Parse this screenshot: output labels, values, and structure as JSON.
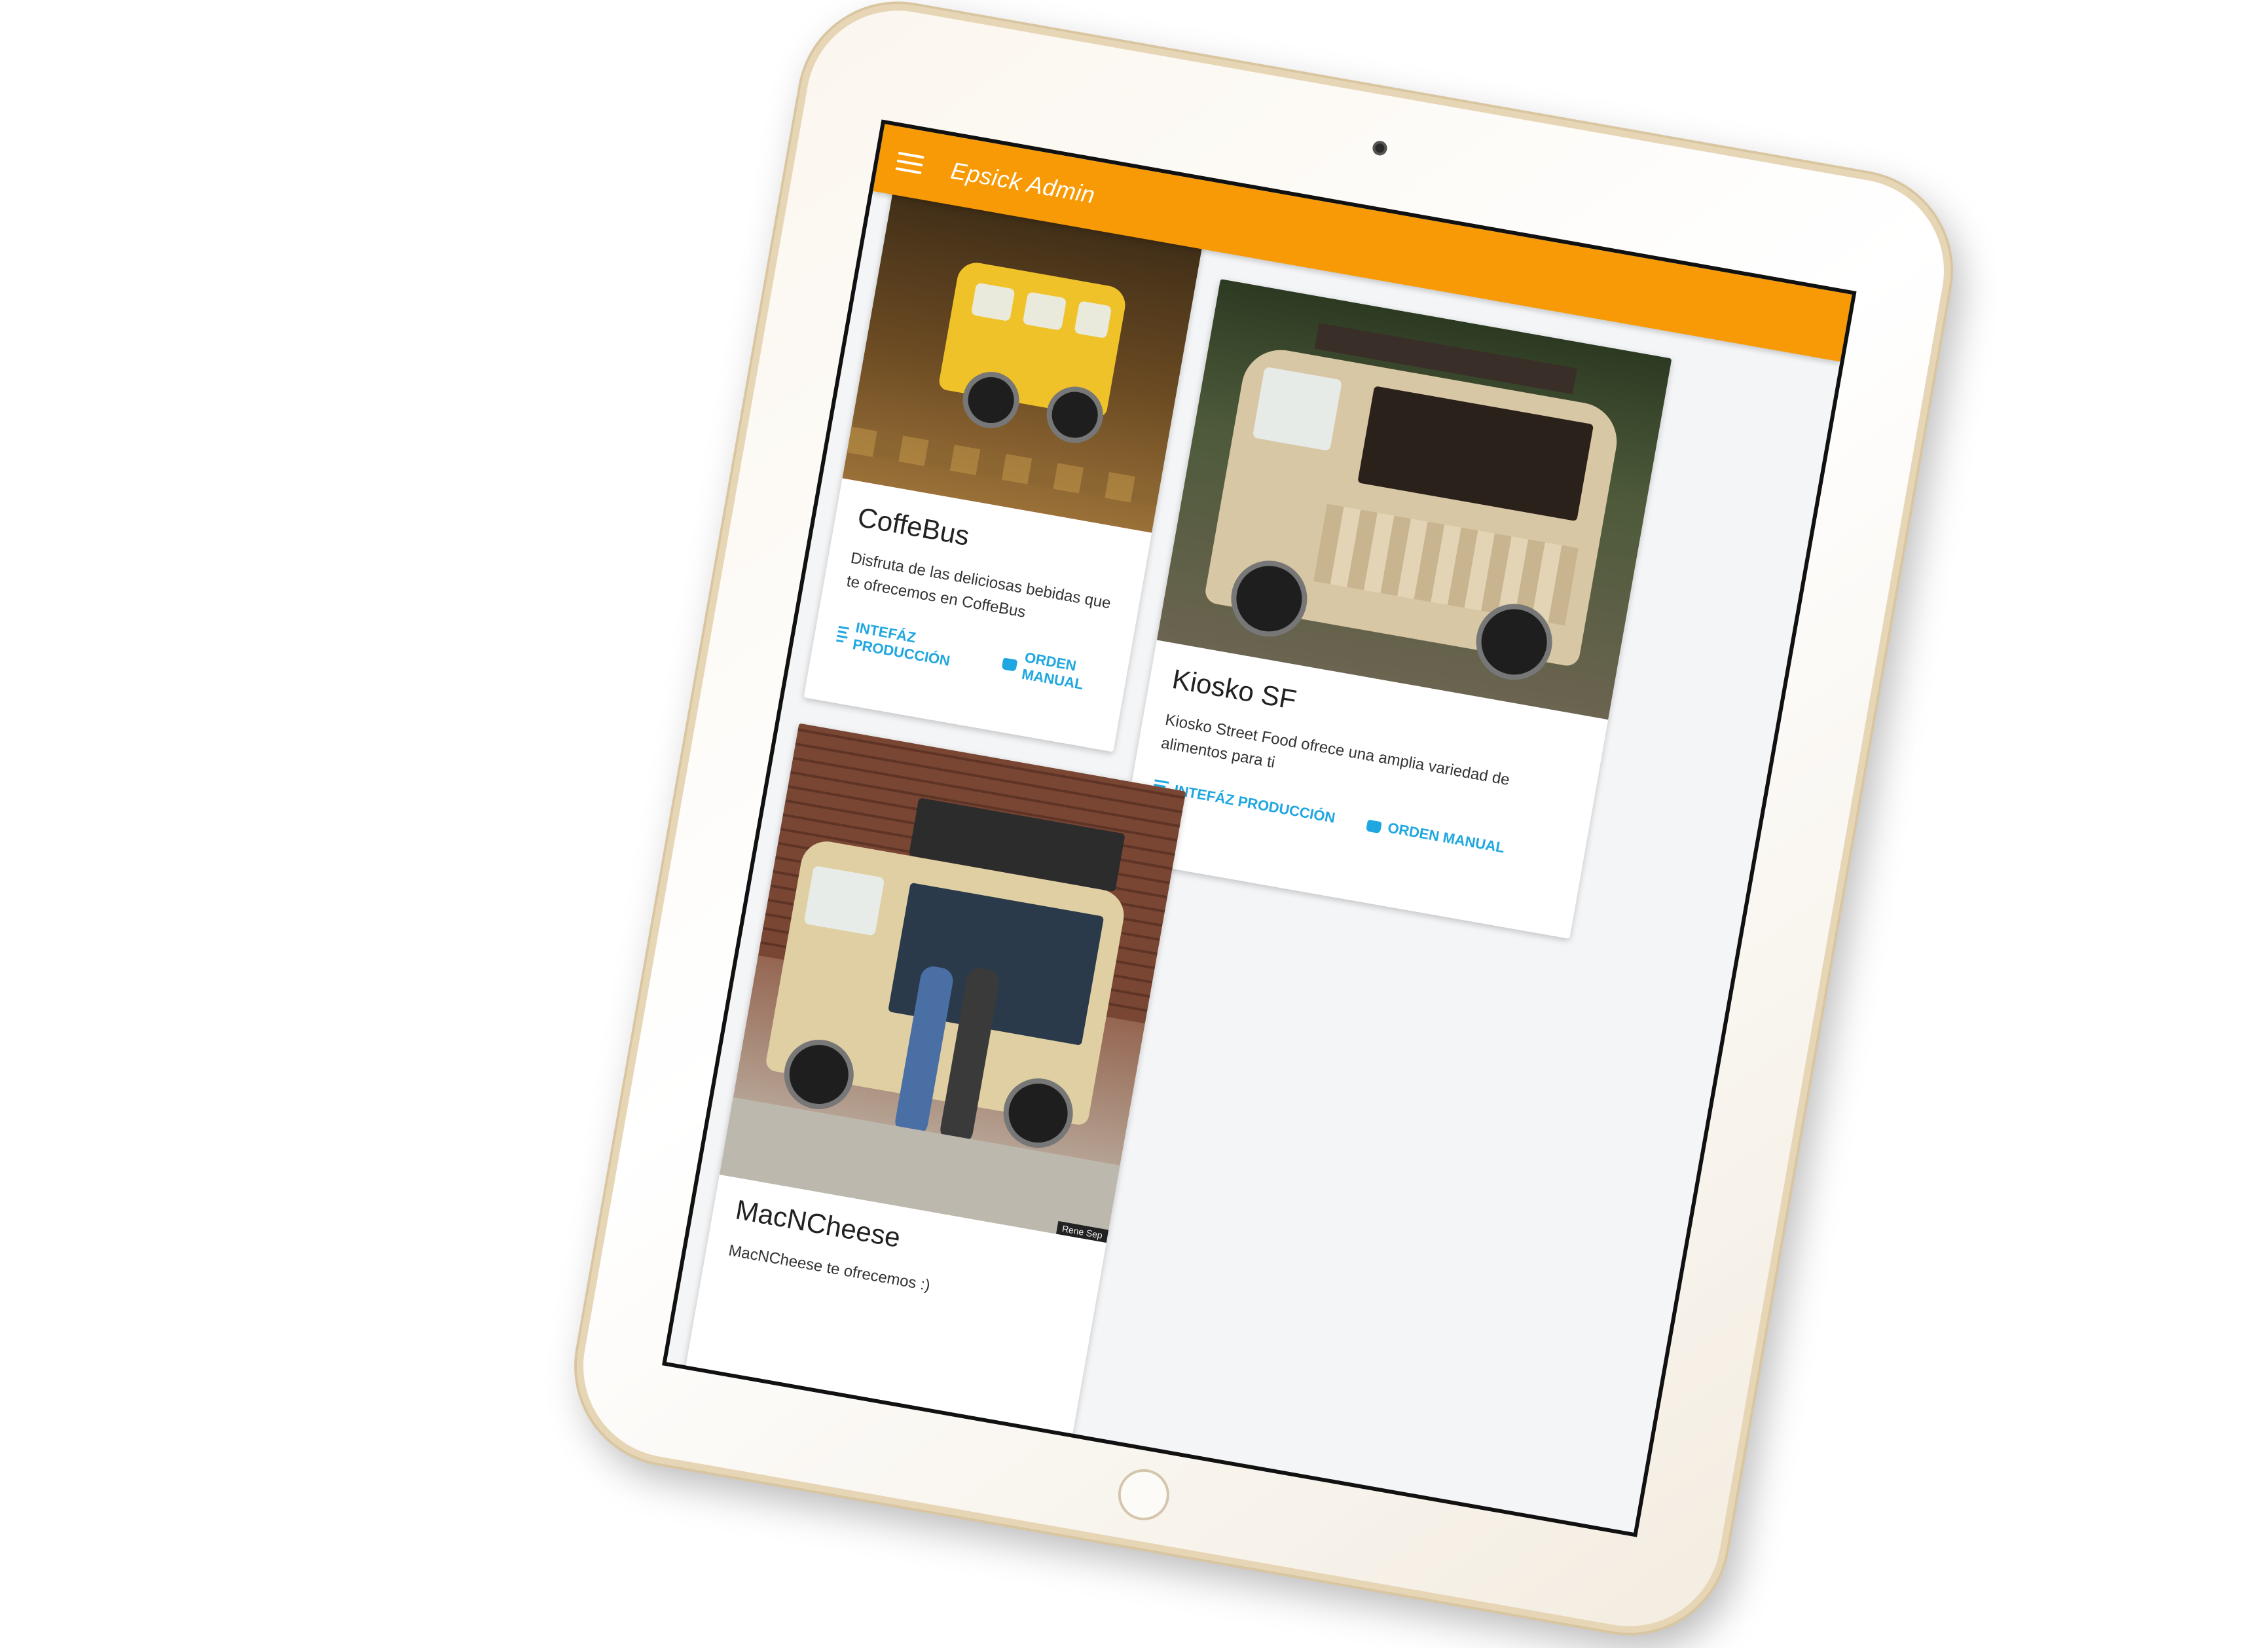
{
  "app": {
    "title": "Epsick Admin"
  },
  "cards": [
    {
      "title": "CoffeBus",
      "description": "Disfruta de las deliciosas bebidas que te ofrecemos en CoffeBus",
      "actions": {
        "production": "Intefáz Producción",
        "manual": "Orden Manual"
      }
    },
    {
      "title": "Kiosko SF",
      "description": "Kiosko Street Food ofrece una amplia variedad de alimentos para ti",
      "actions": {
        "production": "Intefáz Producción",
        "manual": "Orden Manual"
      }
    },
    {
      "title": "MacNCheese",
      "description": "MacNCheese te ofrecemos :)",
      "photo_credit": "Rene Sep"
    }
  ],
  "colors": {
    "appbar": "#f79a05",
    "accent": "#1ea7e0"
  },
  "icons": {
    "menu": "hamburger-menu-icon",
    "production": "list-icon",
    "manual": "shopping-bag-icon"
  }
}
